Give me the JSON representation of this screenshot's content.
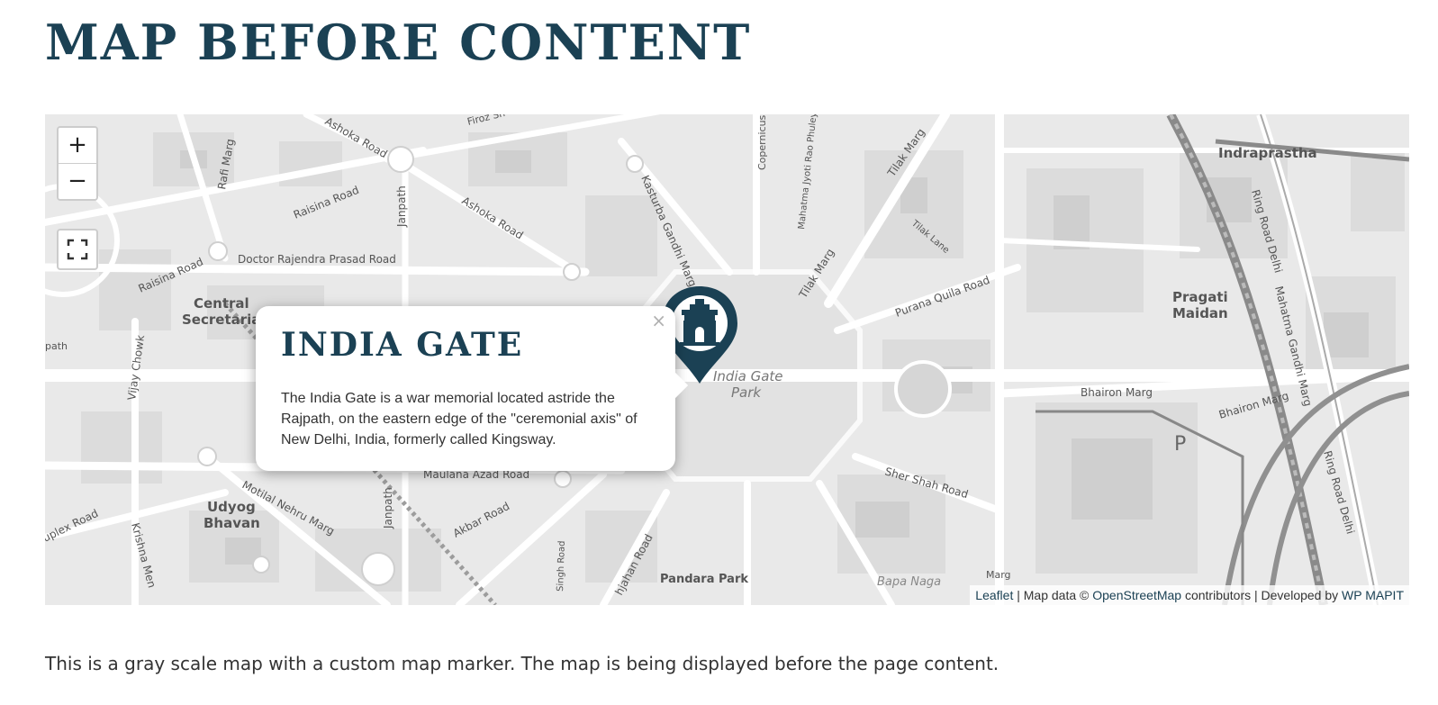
{
  "page_title": "MAP BEFORE CONTENT",
  "map": {
    "zoom_in": "+",
    "zoom_out": "−",
    "fullscreen_icon": "fullscreen-icon",
    "marker_icon": "india-gate-marker-icon",
    "marker_color": "#1b4154",
    "labels": {
      "central_secretariat_1": "Central",
      "central_secretariat_2": "Secretariat",
      "udyog_bhavan_1": "Udyog",
      "udyog_bhavan_2": "Bhavan",
      "indraprastha": "Indraprastha",
      "pragati_maidan_1": "Pragati",
      "pragati_maidan_2": "Maidan",
      "india_gate_park_1": "India Gate",
      "india_gate_park_2": "Park",
      "pandara_park": "Pandara Park",
      "bapa_nagar": "Bapa Naga",
      "parking": "P",
      "rafi_marg": "Rafi Marg",
      "ashoka_road": "Ashoka Road",
      "ashoka_road_2": "Ashoka Road",
      "raisina_road": "Raisina Road",
      "raisina_road_2": "Raisina Road",
      "doctor_rajendra": "Doctor Rajendra Prasad Road",
      "janpath": "Janpath",
      "janpath_2": "Janpath",
      "kasturba": "Kasturba Gandhi Marg",
      "copernicus": "Copernicus",
      "jyoti_rao": "Mahatma Jyoti Rao Phuley",
      "tilak_marg": "Tilak Marg",
      "tilak_marg_2": "Tilak Marg",
      "tilak_lane": "Tilak Lane",
      "purana_quila": "Purana Quila Road",
      "ring_road": "Ring Road Delhi",
      "ring_road_2": "Ring Road Delhi",
      "mahatma_gandhi": "Mahatma Gandhi Marg",
      "bhairon_marg": "Bhairon Marg",
      "bhairon_marg_2": "Bhairon Marg",
      "vijay_chowk": "Vijay Chowk",
      "maulana_azad": "Maulana Azad Road",
      "maulana_azad_2": "Maulana Azad Road",
      "motilal": "Motilal Nehru Marg",
      "akbar_road": "Akbar Road",
      "sher_shah": "Sher Shah Road",
      "krishna_menon": "Krishna Men",
      "duplex_road": "uplex Road",
      "shahjahan": "hjahan Road",
      "singh_road": "Singh Road",
      "firoz_shah": "Firoz Sh",
      "path": "path",
      "marg": "Marg"
    },
    "attribution": {
      "leaflet": "Leaflet",
      "sep1": " | Map data © ",
      "osm": "OpenStreetMap",
      "sep2": " contributors | Developed by ",
      "wpmapit": "WP MAPIT"
    }
  },
  "popup": {
    "close": "×",
    "title": "INDIA GATE",
    "body": "The India Gate is a war memorial located astride the Rajpath, on the eastern edge of the \"ceremonial axis\" of New Delhi, India, formerly called Kingsway."
  },
  "caption": "This is a gray scale map with a custom map marker. The map is being displayed before the page content."
}
